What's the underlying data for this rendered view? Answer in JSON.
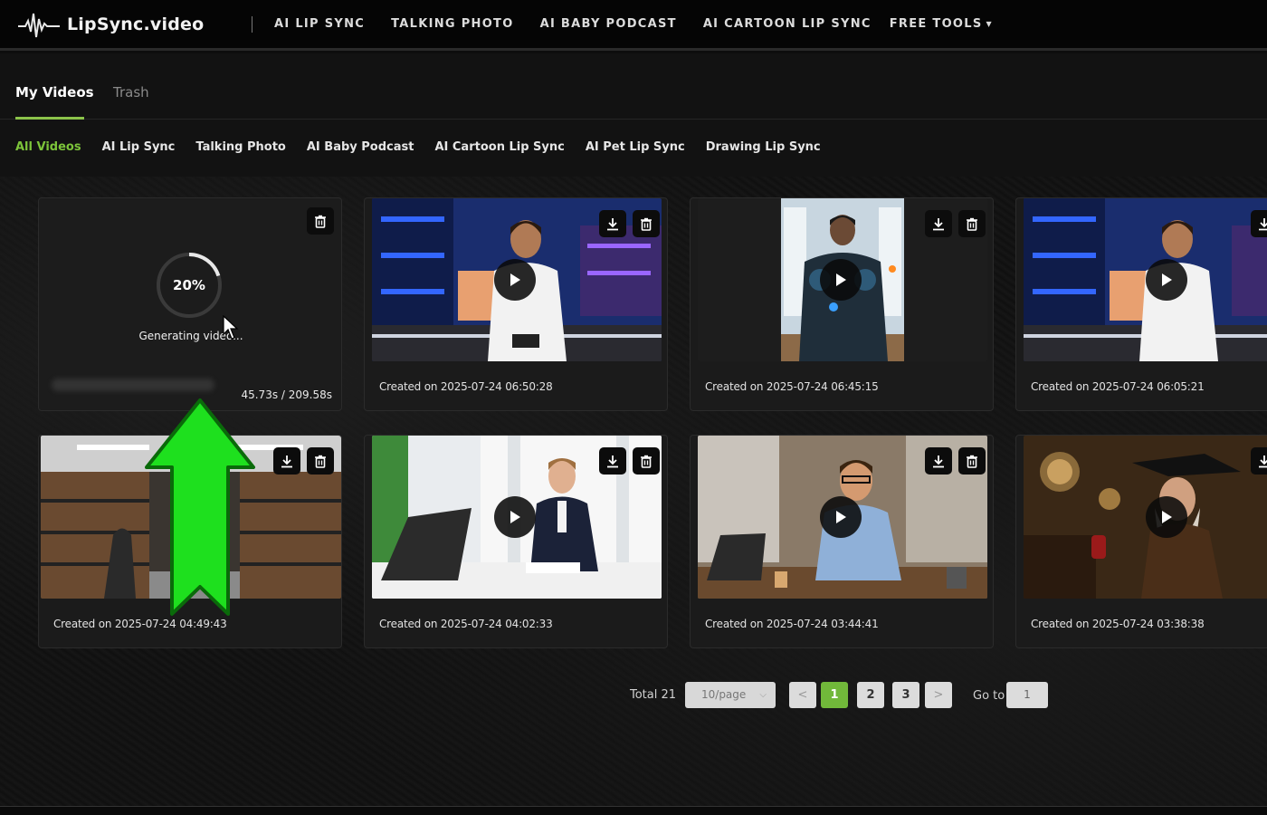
{
  "brand": {
    "name": "LipSync.video",
    "icon": "waveform-logo-icon"
  },
  "nav": {
    "items": [
      "AI LIP SYNC",
      "TALKING PHOTO",
      "AI BABY PODCAST",
      "AI CARTOON LIP SYNC"
    ],
    "tools_label": "FREE TOOLS"
  },
  "tabs": {
    "active": "My Videos",
    "inactive": "Trash"
  },
  "filters": [
    "All Videos",
    "AI Lip Sync",
    "Talking Photo",
    "AI Baby Podcast",
    "AI Cartoon Lip Sync",
    "AI Pet Lip Sync",
    "Drawing Lip Sync"
  ],
  "generating": {
    "progress_text": "20%",
    "progress": 0.2,
    "label": "Generating video...",
    "time": "45.73s / 209.58s"
  },
  "videos": [
    {
      "caption": "Created on 2025-07-24 06:50:28"
    },
    {
      "caption": "Created on 2025-07-24 06:45:15"
    },
    {
      "caption": "Created on 2025-07-24 06:05:21"
    },
    {
      "caption": "Created on 2025-07-24 04:49:43"
    },
    {
      "caption": "Created on 2025-07-24 04:02:33"
    },
    {
      "caption": "Created on 2025-07-24 03:44:41"
    },
    {
      "caption": "Created on 2025-07-24 03:38:38"
    }
  ],
  "pagination": {
    "total": "Total 21",
    "page_size": "10/page",
    "prev": "<",
    "next": ">",
    "pages": [
      "1",
      "2",
      "3"
    ],
    "goto_label": "Go to",
    "goto_value": "1"
  },
  "colors": {
    "accent": "#7cc43a",
    "arrow": "#1ee01e"
  }
}
